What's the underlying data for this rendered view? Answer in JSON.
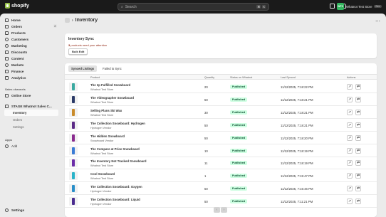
{
  "brand": {
    "name": "shopify"
  },
  "search": {
    "placeholder": "Search",
    "shortcut": [
      "⌘",
      "K"
    ]
  },
  "user": {
    "initials": "WTS",
    "store": "Whatnot Test Store",
    "tag": "Dev"
  },
  "sidebar": {
    "items": [
      {
        "label": "Home"
      },
      {
        "label": "Orders",
        "badge": "2"
      },
      {
        "label": "Products"
      },
      {
        "label": "Customers"
      },
      {
        "label": "Marketing"
      },
      {
        "label": "Discounts"
      },
      {
        "label": "Content"
      },
      {
        "label": "Markets"
      },
      {
        "label": "Finance"
      },
      {
        "label": "Analytics"
      }
    ],
    "sales_channels_label": "Sales channels",
    "online_store": "Online Store",
    "app_name": "STAGE Whatnot Sales C...",
    "app_sub": [
      "Inventory",
      "Orders",
      "Settings"
    ],
    "apps_label": "Apps",
    "add": "Add",
    "settings": "Settings"
  },
  "page": {
    "title": "Inventory",
    "more": "⋯"
  },
  "sync_card": {
    "title": "Inventory Sync",
    "count": "3",
    "message": "products need your attention",
    "button": "Bulk Edit"
  },
  "tabs": [
    "Synced Listings",
    "Failed to Sync"
  ],
  "columns": {
    "product": "Product",
    "quantity": "Quantity",
    "status": "Status on Whatnot",
    "synced": "Last Synced",
    "actions": "Actions"
  },
  "products": [
    {
      "name": "The 3p Fulfilled Snowboard",
      "vendor": "Whatnot Test Store",
      "qty": "20",
      "status": "Published",
      "date": "11/12/2025, 7:18:22 PM",
      "color": "#3aa9a0"
    },
    {
      "name": "The Videographer Snowboard",
      "vendor": "Whatnot Test Store",
      "qty": "50",
      "status": "Published",
      "date": "11/12/2025, 7:18:21 PM",
      "color": "#2b3a67"
    },
    {
      "name": "Selling Plans Ski Wax",
      "vendor": "Whatnot Test Store",
      "qty": "30",
      "status": "Published",
      "date": "11/12/2025, 7:18:21 PM",
      "color": "#c98b2b"
    },
    {
      "name": "The Collection Snowboard: Hydrogen",
      "vendor": "Hydrogen Vendor",
      "qty": "50",
      "status": "Published",
      "date": "11/12/2025, 7:18:21 PM",
      "color": "#5b2a86"
    },
    {
      "name": "The Hidden Snowboard",
      "vendor": "Snowboard Vendor",
      "qty": "50",
      "status": "Published",
      "date": "11/12/2025, 7:18:20 PM",
      "color": "#8a2b8f"
    },
    {
      "name": "The Compare at Price Snowboard",
      "vendor": "Whatnot Test Store",
      "qty": "10",
      "status": "Published",
      "date": "11/12/2025, 7:18:19 PM",
      "color": "#3a7bd5"
    },
    {
      "name": "The Inventory Not Tracked Snowboard",
      "vendor": "Whatnot Test Store",
      "qty": "11",
      "status": "Published",
      "date": "11/12/2025, 7:18:19 PM",
      "color": "#6b2ca8"
    },
    {
      "name": "Cool Snowboard",
      "vendor": "Whatnot Test Store",
      "qty": "1",
      "status": "Published",
      "date": "11/12/2025, 7:15:47 PM",
      "color": "#2ab3c9"
    },
    {
      "name": "The Collection Snowboard: Oxygen",
      "vendor": "Hydrogen Vendor",
      "qty": "50",
      "status": "Published",
      "date": "11/12/2025, 7:15:46 PM",
      "color": "#2a8fc9"
    },
    {
      "name": "The Collection Snowboard: Liquid",
      "vendor": "Hydrogen Vendor",
      "qty": "50",
      "status": "Published",
      "date": "11/12/2025, 7:11:21 PM",
      "color": "#4a2b8f"
    }
  ],
  "actions": {
    "open": "↗",
    "sync": "⇄"
  },
  "pager": {
    "prev": "‹",
    "next": "›"
  }
}
